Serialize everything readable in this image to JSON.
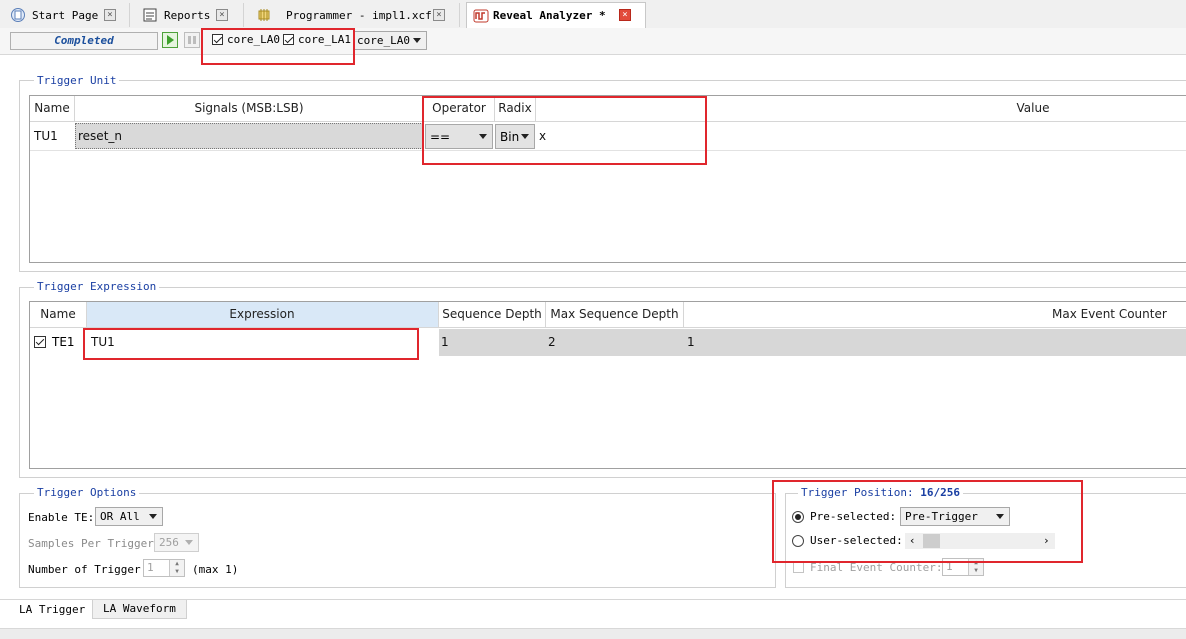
{
  "tabs": [
    {
      "label": "Start Page",
      "icon": "start-page-icon",
      "close": "×"
    },
    {
      "label": "Reports",
      "icon": "reports-icon",
      "close": "×"
    },
    {
      "label": "Programmer - impl1.xcf",
      "icon": "programmer-icon",
      "close": "×"
    },
    {
      "label": "Reveal Analyzer *",
      "icon": "reveal-analyzer-icon",
      "close": "×"
    }
  ],
  "toolbar": {
    "status": "Completed",
    "core_checks": [
      {
        "label": "core_LA0",
        "checked": true
      },
      {
        "label": "core_LA1",
        "checked": true
      }
    ],
    "core_select": "core_LA0"
  },
  "trigger_unit": {
    "title": "Trigger Unit",
    "columns": [
      "Name",
      "Signals (MSB:LSB)",
      "Operator",
      "Radix",
      "Value"
    ],
    "rows": [
      {
        "name": "TU1",
        "signals": "reset_n",
        "operator": "==",
        "radix": "Bin",
        "value": "x"
      }
    ]
  },
  "trigger_expression": {
    "title": "Trigger Expression",
    "columns": [
      "Name",
      "Expression",
      "Sequence Depth",
      "Max Sequence Depth",
      "Max Event Counter"
    ],
    "rows": [
      {
        "checked": true,
        "name": "TE1",
        "expression": "TU1",
        "sequence_depth": "1",
        "max_sequence_depth": "2",
        "max_event_counter": "1"
      }
    ]
  },
  "trigger_options": {
    "title": "Trigger Options",
    "enable_te_label": "Enable TE:",
    "enable_te_value": "OR All",
    "samples_label": "Samples Per Trigger:",
    "samples_value": "256",
    "number_label": "Number of Trigger:",
    "number_value": "1",
    "number_max": "(max 1)"
  },
  "trigger_position": {
    "title": "Trigger Position:",
    "value": "16/256",
    "preselected_label": "Pre-selected:",
    "preselected_value": "Pre-Trigger",
    "preselected_on": true,
    "userselected_label": "User-selected:",
    "final_event_label": "Final Event Counter:",
    "final_event_value": "1"
  },
  "bottom_tabs": [
    "LA Trigger",
    "LA Waveform"
  ],
  "colors": {
    "accent_blue": "#1a3fa3",
    "highlight_red": "#e0262d",
    "header_selected": "#d9e8f7"
  }
}
